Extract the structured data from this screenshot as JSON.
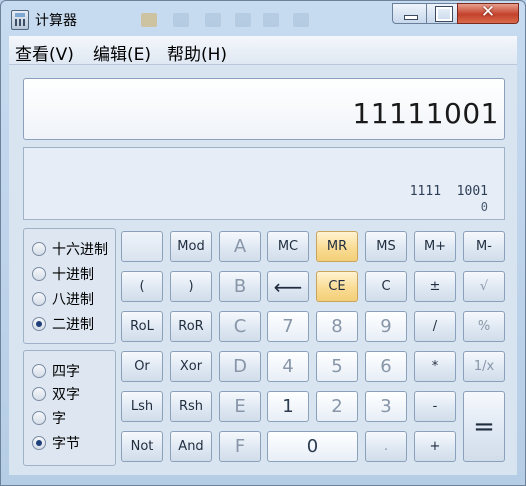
{
  "window": {
    "title": "计算器"
  },
  "menu": [
    "查看(V)",
    "编辑(E)",
    "帮助(H)"
  ],
  "display": {
    "value": "11111001",
    "bits_line1": "1111  1001",
    "bits_line2": "0"
  },
  "base_options": [
    {
      "label": "十六进制",
      "checked": false
    },
    {
      "label": "十进制",
      "checked": false
    },
    {
      "label": "八进制",
      "checked": false
    },
    {
      "label": "二进制",
      "checked": true
    }
  ],
  "word_options": [
    {
      "label": "四字",
      "checked": false
    },
    {
      "label": "双字",
      "checked": false
    },
    {
      "label": "字",
      "checked": false
    },
    {
      "label": "字节",
      "checked": true
    }
  ],
  "buttons": {
    "r1": [
      "",
      "Mod",
      "A",
      "MC",
      "MR",
      "MS",
      "M+",
      "M-"
    ],
    "r2": [
      "(",
      ")",
      "B",
      "⟵",
      "CE",
      "C",
      "±",
      "√"
    ],
    "r3": [
      "RoL",
      "RoR",
      "C",
      "7",
      "8",
      "9",
      "/",
      "%"
    ],
    "r4": [
      "Or",
      "Xor",
      "D",
      "4",
      "5",
      "6",
      "*",
      "1/x"
    ],
    "r5": [
      "Lsh",
      "Rsh",
      "E",
      "1",
      "2",
      "3",
      "-",
      "="
    ],
    "r6": [
      "Not",
      "And",
      "F",
      "0",
      ".",
      "+"
    ]
  }
}
